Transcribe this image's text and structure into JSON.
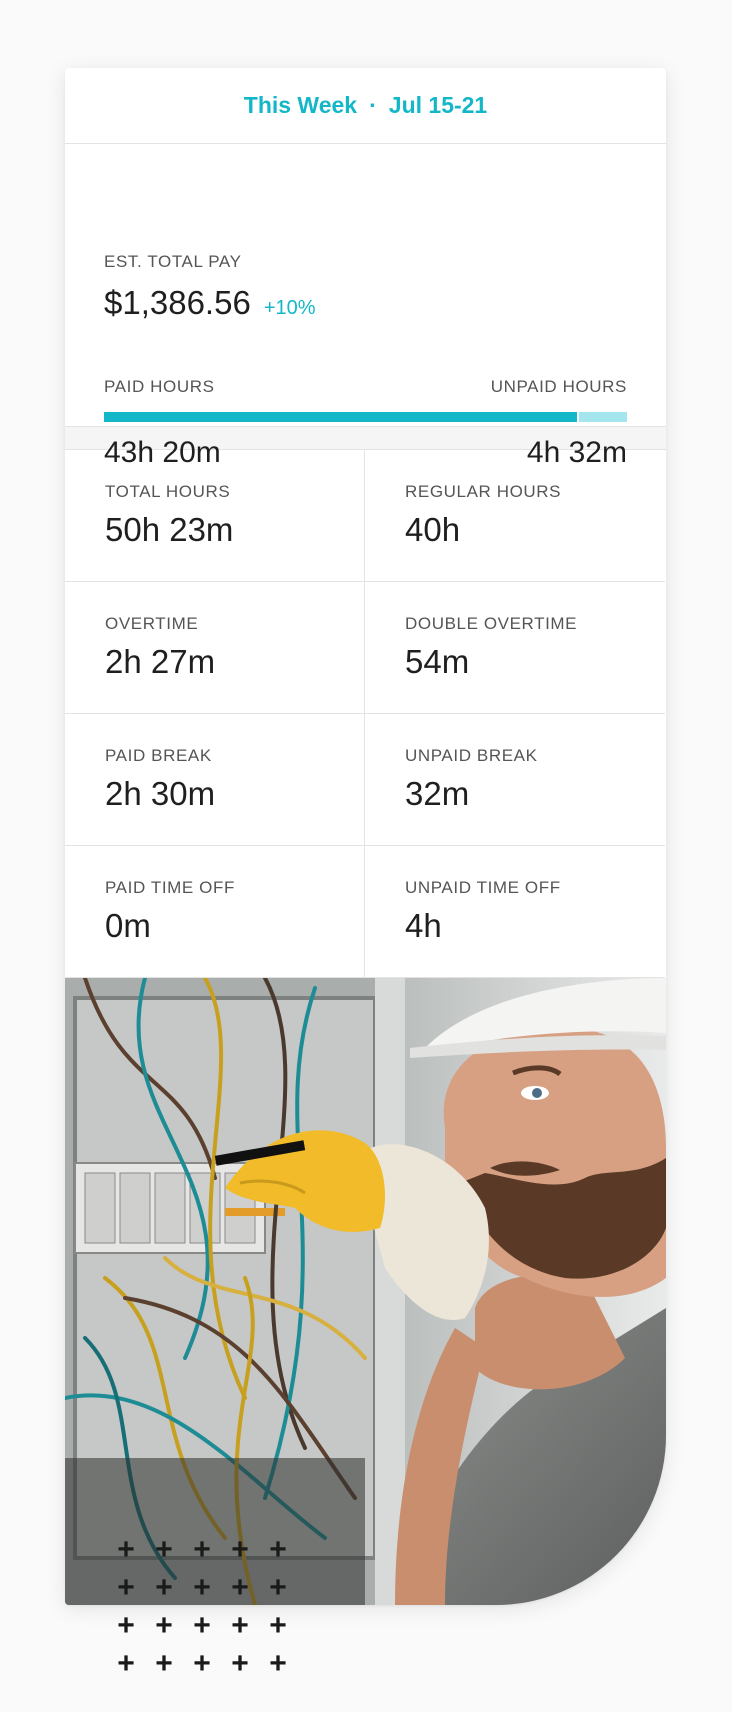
{
  "header": {
    "period": "This Week",
    "dates": "Jul 15-21"
  },
  "pay": {
    "label": "EST. TOTAL PAY",
    "amount": "$1,386.56",
    "change": "+10%",
    "paid_label": "PAID HOURS",
    "unpaid_label": "UNPAID HOURS",
    "paid_value": "43h 20m",
    "unpaid_value": "4h 32m",
    "paid_fraction": 0.905
  },
  "stats": [
    {
      "label": "TOTAL HOURS",
      "value": "50h 23m"
    },
    {
      "label": "REGULAR HOURS",
      "value": "40h"
    },
    {
      "label": "OVERTIME",
      "value": "2h 27m"
    },
    {
      "label": "DOUBLE OVERTIME",
      "value": "54m"
    },
    {
      "label": "PAID BREAK",
      "value": "2h 30m"
    },
    {
      "label": "UNPAID BREAK",
      "value": "32m"
    },
    {
      "label": "PAID TIME OFF",
      "value": "0m"
    },
    {
      "label": "UNPAID TIME OFF",
      "value": "4h"
    }
  ],
  "colors": {
    "accent": "#13b7c8",
    "accent_light": "#a5e6ee"
  },
  "decor": {
    "plus_glyph": "+"
  }
}
